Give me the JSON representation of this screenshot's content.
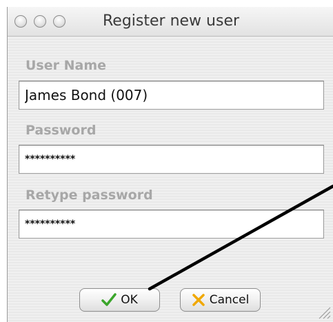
{
  "window": {
    "title": "Register new user"
  },
  "form": {
    "username": {
      "label": "User Name",
      "value": "James Bond (007)"
    },
    "password": {
      "label": "Password",
      "value": "**********"
    },
    "retype": {
      "label": "Retype password",
      "value": "**********"
    }
  },
  "buttons": {
    "ok": "OK",
    "cancel": "Cancel"
  },
  "icons": {
    "ok": "checkmark-icon",
    "cancel": "x-icon"
  },
  "colors": {
    "check": "#3aa52b",
    "cross": "#f0a800",
    "annotation": "#000000"
  }
}
